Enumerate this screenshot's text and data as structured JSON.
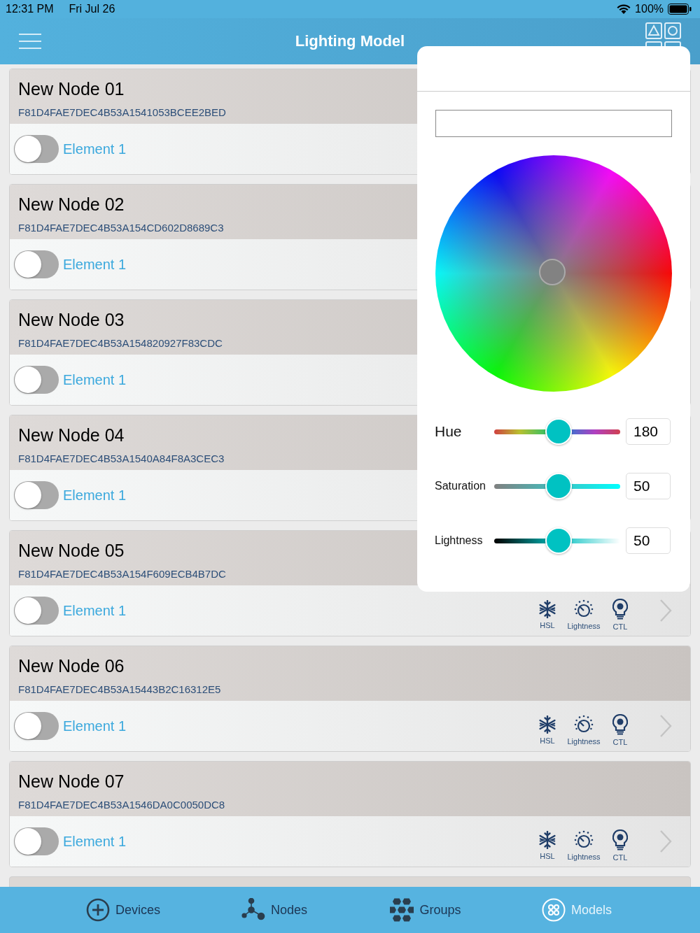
{
  "status_bar": {
    "time": "12:31 PM",
    "date": "Fri Jul 26",
    "battery": "100%"
  },
  "header": {
    "title": "Lighting Model"
  },
  "nodes": [
    {
      "name": "New Node 01",
      "uuid": "F81D4FAE7DEC4B53A1541053BCEE2BED",
      "element": {
        "label": "Element 1",
        "on": false
      }
    },
    {
      "name": "New Node 02",
      "uuid": "F81D4FAE7DEC4B53A154CD602D8689C3",
      "element": {
        "label": "Element 1",
        "on": false
      }
    },
    {
      "name": "New Node 03",
      "uuid": "F81D4FAE7DEC4B53A154820927F83CDC",
      "element": {
        "label": "Element 1",
        "on": false
      }
    },
    {
      "name": "New Node 04",
      "uuid": "F81D4FAE7DEC4B53A1540A84F8A3CEC3",
      "element": {
        "label": "Element 1",
        "on": false
      }
    },
    {
      "name": "New Node 05",
      "uuid": "F81D4FAE7DEC4B53A154F609ECB4B7DC",
      "element": {
        "label": "Element 1",
        "on": false
      },
      "actions": [
        {
          "kind": "hsl",
          "label": "HSL"
        },
        {
          "kind": "lightness",
          "label": "Lightness"
        },
        {
          "kind": "ctl",
          "label": "CTL"
        }
      ]
    },
    {
      "name": "New Node 06",
      "uuid": "F81D4FAE7DEC4B53A15443B2C16312E5",
      "element": {
        "label": "Element 1",
        "on": false
      },
      "actions": [
        {
          "kind": "hsl",
          "label": "HSL"
        },
        {
          "kind": "lightness",
          "label": "Lightness"
        },
        {
          "kind": "ctl",
          "label": "CTL"
        }
      ]
    },
    {
      "name": "New Node 07",
      "uuid": "F81D4FAE7DEC4B53A1546DA0C0050DC8",
      "element": {
        "label": "Element 1",
        "on": false
      },
      "actions": [
        {
          "kind": "hsl",
          "label": "HSL"
        },
        {
          "kind": "lightness",
          "label": "Lightness"
        },
        {
          "kind": "ctl",
          "label": "CTL"
        }
      ]
    }
  ],
  "color_picker": {
    "sliders": [
      {
        "kind": "hue",
        "label": "Hue",
        "level": 0.5,
        "value": "180"
      },
      {
        "kind": "saturation",
        "label": "Saturation",
        "level": 0.5,
        "value": "50"
      },
      {
        "kind": "lightness",
        "label": "Lightness",
        "level": 0.5,
        "value": "50"
      }
    ]
  },
  "tabs": [
    {
      "kind": "devices",
      "label": "Devices",
      "selected": false
    },
    {
      "kind": "nodes",
      "label": "Nodes",
      "selected": false
    },
    {
      "kind": "groups",
      "label": "Groups",
      "selected": false
    },
    {
      "kind": "models",
      "label": "Models",
      "selected": true
    }
  ]
}
